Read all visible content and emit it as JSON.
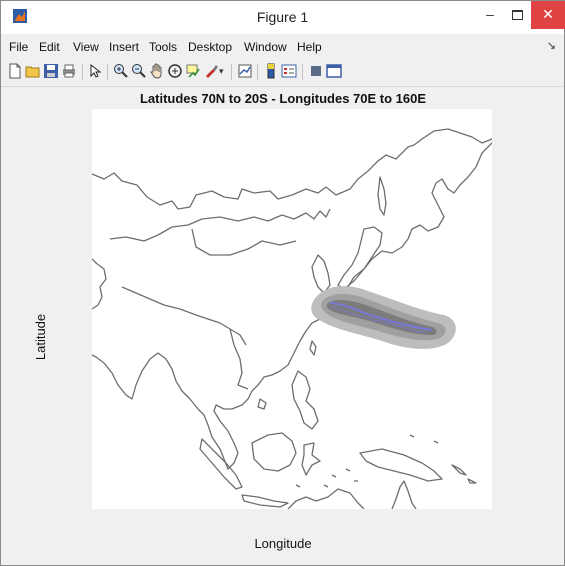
{
  "window": {
    "title": "Figure 1"
  },
  "menu": [
    "File",
    "Edit",
    "View",
    "Insert",
    "Tools",
    "Desktop",
    "Window",
    "Help"
  ],
  "toolbar": {
    "icons": [
      "new-figure-icon",
      "open-file-icon",
      "save-icon",
      "print-icon",
      "edit-plot-arrow-icon",
      "zoom-in-icon",
      "zoom-out-icon",
      "pan-hand-icon",
      "rotate-3d-icon",
      "data-cursor-icon",
      "brush-icon",
      "brush-dropdown-icon",
      "link-plot-icon",
      "colorbar-icon",
      "legend-icon",
      "hide-plot-tools-icon",
      "show-plot-tools-icon"
    ]
  },
  "figure": {
    "title": "Latitudes 70N to 20S - Longitudes 70E to 160E",
    "xlabel": "Longitude",
    "ylabel": "Latitude"
  },
  "colors": {
    "coastline": "#6e6e6e",
    "shade_outer": "#bdbdbd",
    "shade_mid": "#a0a0a0",
    "shade_inner": "#7c7c7c",
    "track": "#7878d8",
    "close": "#e04343"
  }
}
